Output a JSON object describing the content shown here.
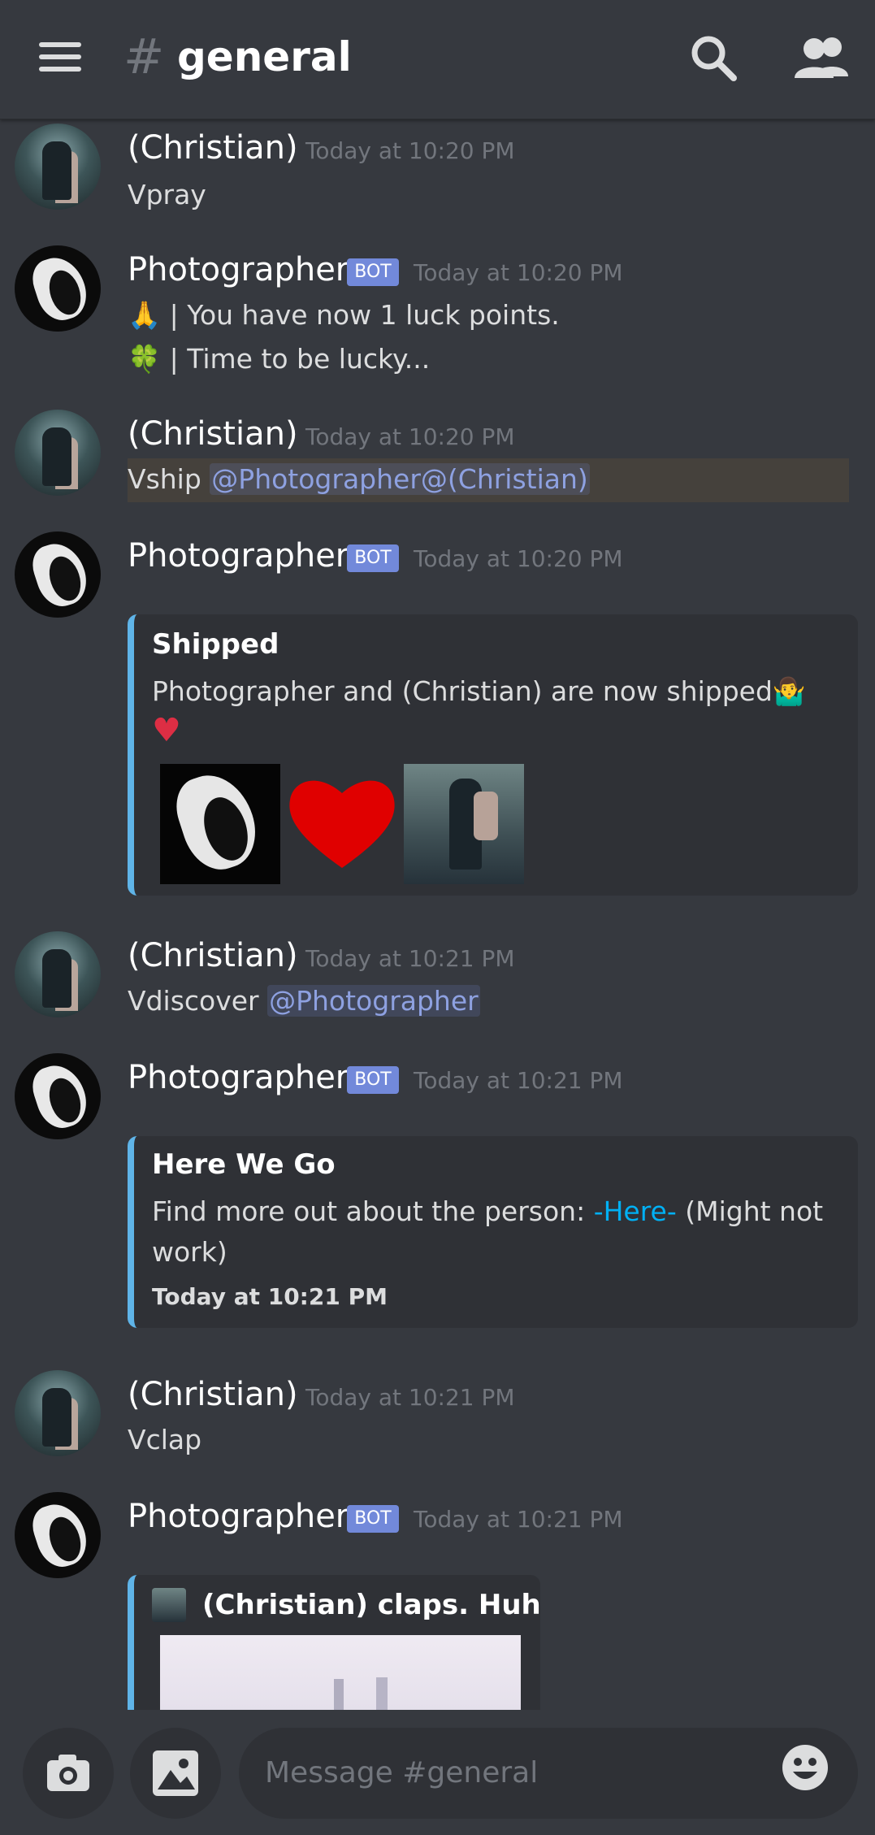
{
  "header": {
    "hash": "#",
    "channel": "general",
    "icons": [
      "menu-icon",
      "search-icon",
      "members-icon"
    ]
  },
  "messages": [
    {
      "author": "(Christian)",
      "timestamp": "Today at 10:20 PM",
      "lines": [
        "Vpray"
      ]
    },
    {
      "author": "Photographer",
      "bot_tag": "BOT",
      "timestamp": "Today at 10:20 PM",
      "lines": [
        {
          "emoji": "🙏",
          "text": " | You have now 1 luck points."
        },
        {
          "emoji": "🍀",
          "text": " | Time to be lucky..."
        }
      ]
    },
    {
      "author": "(Christian)",
      "timestamp": "Today at 10:20 PM",
      "text": "Vship ",
      "mentions": "@Photographer@(Christian)"
    },
    {
      "author": "Photographer",
      "bot_tag": "BOT",
      "timestamp": "Today at 10:20 PM",
      "embed": {
        "title": "Shipped",
        "description": "Photographer and (Christian) are now shipped🤷‍♂️",
        "heart": "♥"
      }
    },
    {
      "author": "(Christian)",
      "timestamp": "Today at 10:21 PM",
      "text": "Vdiscover ",
      "mentions": "@Photographer"
    },
    {
      "author": "Photographer",
      "bot_tag": "BOT",
      "timestamp": "Today at 10:21 PM",
      "embed": {
        "title": "Here We Go",
        "desc_before": "Find more out about the person: ",
        "link": "-Here-",
        "desc_after": " (Might not",
        "desc_line2": "work)",
        "footer": "Today at 10:21 PM"
      }
    },
    {
      "author": "(Christian)",
      "timestamp": "Today at 10:21 PM",
      "lines": [
        "Vclap"
      ]
    },
    {
      "author": "Photographer",
      "bot_tag": "BOT",
      "timestamp": "Today at 10:21 PM",
      "embed": {
        "title": "(Christian) claps. Huh?"
      }
    }
  ],
  "composer": {
    "placeholder": "Message #general",
    "icons": [
      "camera-icon",
      "image-icon",
      "emoji-icon"
    ]
  },
  "colors": {
    "background": "#36393f",
    "embed_bg": "#2f3136",
    "embed_accent": "#5fb4e8",
    "bot_tag": "#7289da",
    "mention": "#8ea1e1",
    "link": "#00b0f4",
    "timestamp": "#72767d"
  }
}
